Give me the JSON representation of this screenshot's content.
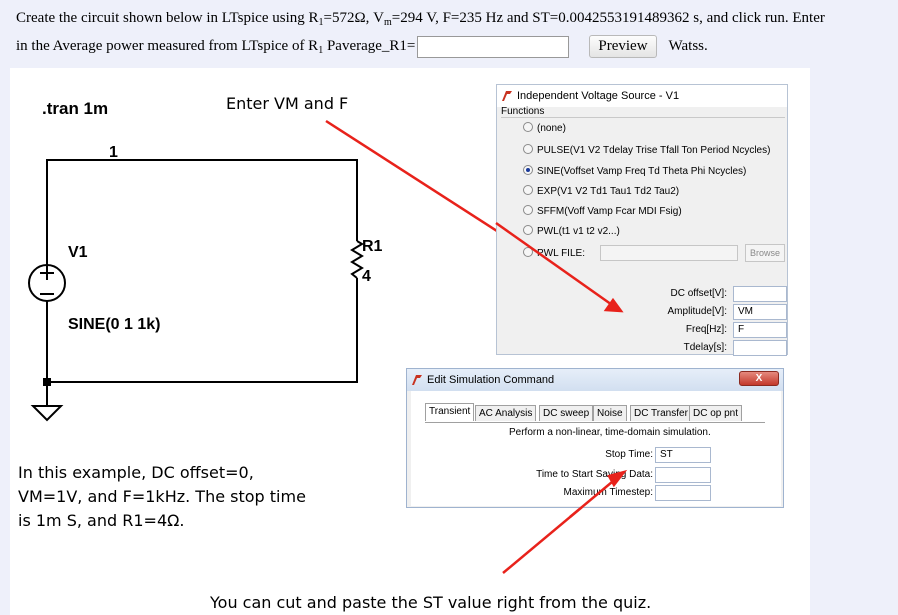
{
  "question": {
    "part1": "Create the circuit shown below in LTspice  using R",
    "sub1": "1",
    "part2": "=572Ω, V",
    "sub2": "m",
    "part3": "=294 V, F=235 Hz and ST=0.0042553191489362 s, and click run. Enter",
    "part4": "in the Average power measured from LTspice  of  R",
    "sub3": "1",
    "part5": " Paverage_R1=",
    "answer_value": "",
    "preview_label": "Preview",
    "unit": "Watss."
  },
  "schematic": {
    "tran": ".tran 1m",
    "node": "1",
    "source_name": "V1",
    "source_value": "SINE(0 1 1k)",
    "resistor_name": "R1",
    "resistor_value": "4",
    "note_enter": "Enter VM and F",
    "note_example_1": "In this example, DC offset=0,",
    "note_example_2": "VM=1V, and F=1kHz. The stop time",
    "note_example_3": "is 1m S, and R1=4Ω.",
    "note_paste": "You can cut and paste the ST value right from the quiz."
  },
  "source_dialog": {
    "title": "Independent Voltage Source - V1",
    "group_label": "Functions",
    "options": [
      "(none)",
      "PULSE(V1 V2 Tdelay Trise Tfall Ton Period Ncycles)",
      "SINE(Voffset Vamp Freq Td Theta Phi Ncycles)",
      "EXP(V1 V2 Td1 Tau1 Td2 Tau2)",
      "SFFM(Voff Vamp Fcar MDI Fsig)",
      "PWL(t1 v1 t2 v2...)",
      "PWL FILE:"
    ],
    "browse_label": "Browse",
    "fields": [
      {
        "label": "DC offset[V]:",
        "value": ""
      },
      {
        "label": "Amplitude[V]:",
        "value": "VM"
      },
      {
        "label": "Freq[Hz]:",
        "value": "F"
      },
      {
        "label": "Tdelay[s]:",
        "value": ""
      }
    ]
  },
  "sim_dialog": {
    "title": "Edit Simulation Command",
    "close_label": "X",
    "tabs": [
      "Transient",
      "AC Analysis",
      "DC sweep",
      "Noise",
      "DC Transfer",
      "DC op pnt"
    ],
    "description": "Perform a non-linear, time-domain simulation.",
    "fields": [
      {
        "label": "Stop Time:",
        "value": "ST"
      },
      {
        "label": "Time to Start Saving Data:",
        "value": ""
      },
      {
        "label": "Maximum Timestep:",
        "value": ""
      }
    ]
  },
  "colors": {
    "arrow": "#e8221b",
    "wire": "#000000",
    "dialog_bg": "#f0f0f0",
    "dialog_title_bg": "#dbe6f4",
    "close_button": "#c9473a"
  }
}
